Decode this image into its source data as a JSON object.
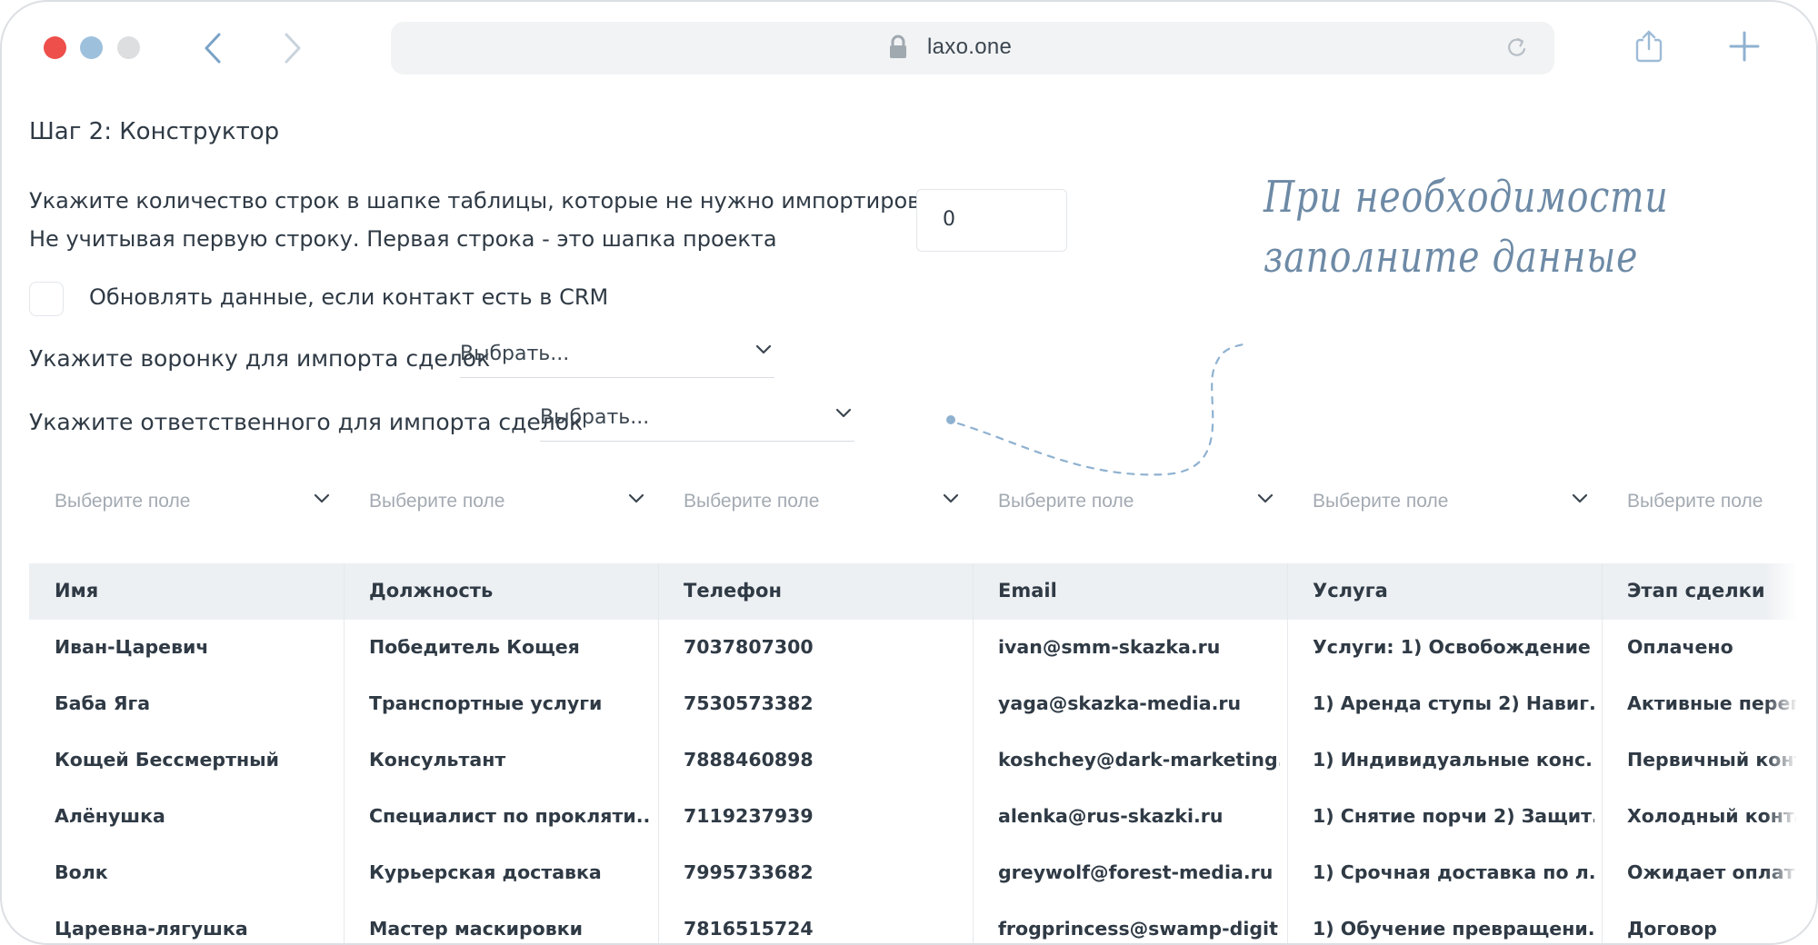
{
  "browser": {
    "url": "laxo.one",
    "traffic_light_colors": [
      "#ee4f4b",
      "#9dc0dd",
      "#dcdee0"
    ]
  },
  "page": {
    "step_title": "Шаг 2: Конструктор",
    "rows_instruction": "Укажите количество строк в шапке таблицы, которые не нужно импортировать",
    "rows_hint": "Не учитывая первую строку. Первая строка - это шапка проекта",
    "rows_value": "0",
    "update_checkbox_label": "Обновлять данные, если контакт есть в CRM",
    "update_checkbox_checked": false,
    "funnel_label": "Укажите воронку для импорта сделок",
    "funnel_select": "Выбрать...",
    "responsible_label": "Укажите ответственного для импорта сделок",
    "responsible_select": "Выбрать..."
  },
  "note": {
    "line1": "При необходимости",
    "line2": "заполните данные"
  },
  "field_selectors": [
    "Выберите поле",
    "Выберите поле",
    "Выберите поле",
    "Выберите поле",
    "Выберите поле",
    "Выберите поле"
  ],
  "table": {
    "columns": [
      "Имя",
      "Должность",
      "Телефон",
      "Email",
      "Услуга",
      "Этап сделки"
    ],
    "rows": [
      [
        "Иван-Царевич",
        "Победитель Кощея",
        "7037807300",
        "ivan@smm-skazka.ru",
        "Услуги: 1) Освобождение ...",
        "Оплачено"
      ],
      [
        "Баба Яга",
        "Транспортные услуги",
        "7530573382",
        "yaga@skazka-media.ru",
        "1) Аренда ступы 2) Навиг...",
        "Активные перего"
      ],
      [
        "Кощей Бессмертный",
        "Консультант",
        "7888460898",
        "koshchey@dark-marketing...",
        "1) Индивидуальные конс...",
        "Первичный конта"
      ],
      [
        "Алёнушка",
        "Специалист по прокляти...",
        "7119237939",
        "alenka@rus-skazki.ru",
        "1) Снятие порчи 2) Защит...",
        "Холодный контак"
      ],
      [
        "Волк",
        "Курьерская доставка",
        "7995733682",
        "greywolf@forest-media.ru",
        "1) Срочная доставка по л...",
        "Ожидает оплаты"
      ],
      [
        "Царевна-лягушка",
        "Мастер маскировки",
        "7816515724",
        "frogprincess@swamp-digit...",
        "1) Обучение превращени...",
        "Договор"
      ]
    ]
  }
}
